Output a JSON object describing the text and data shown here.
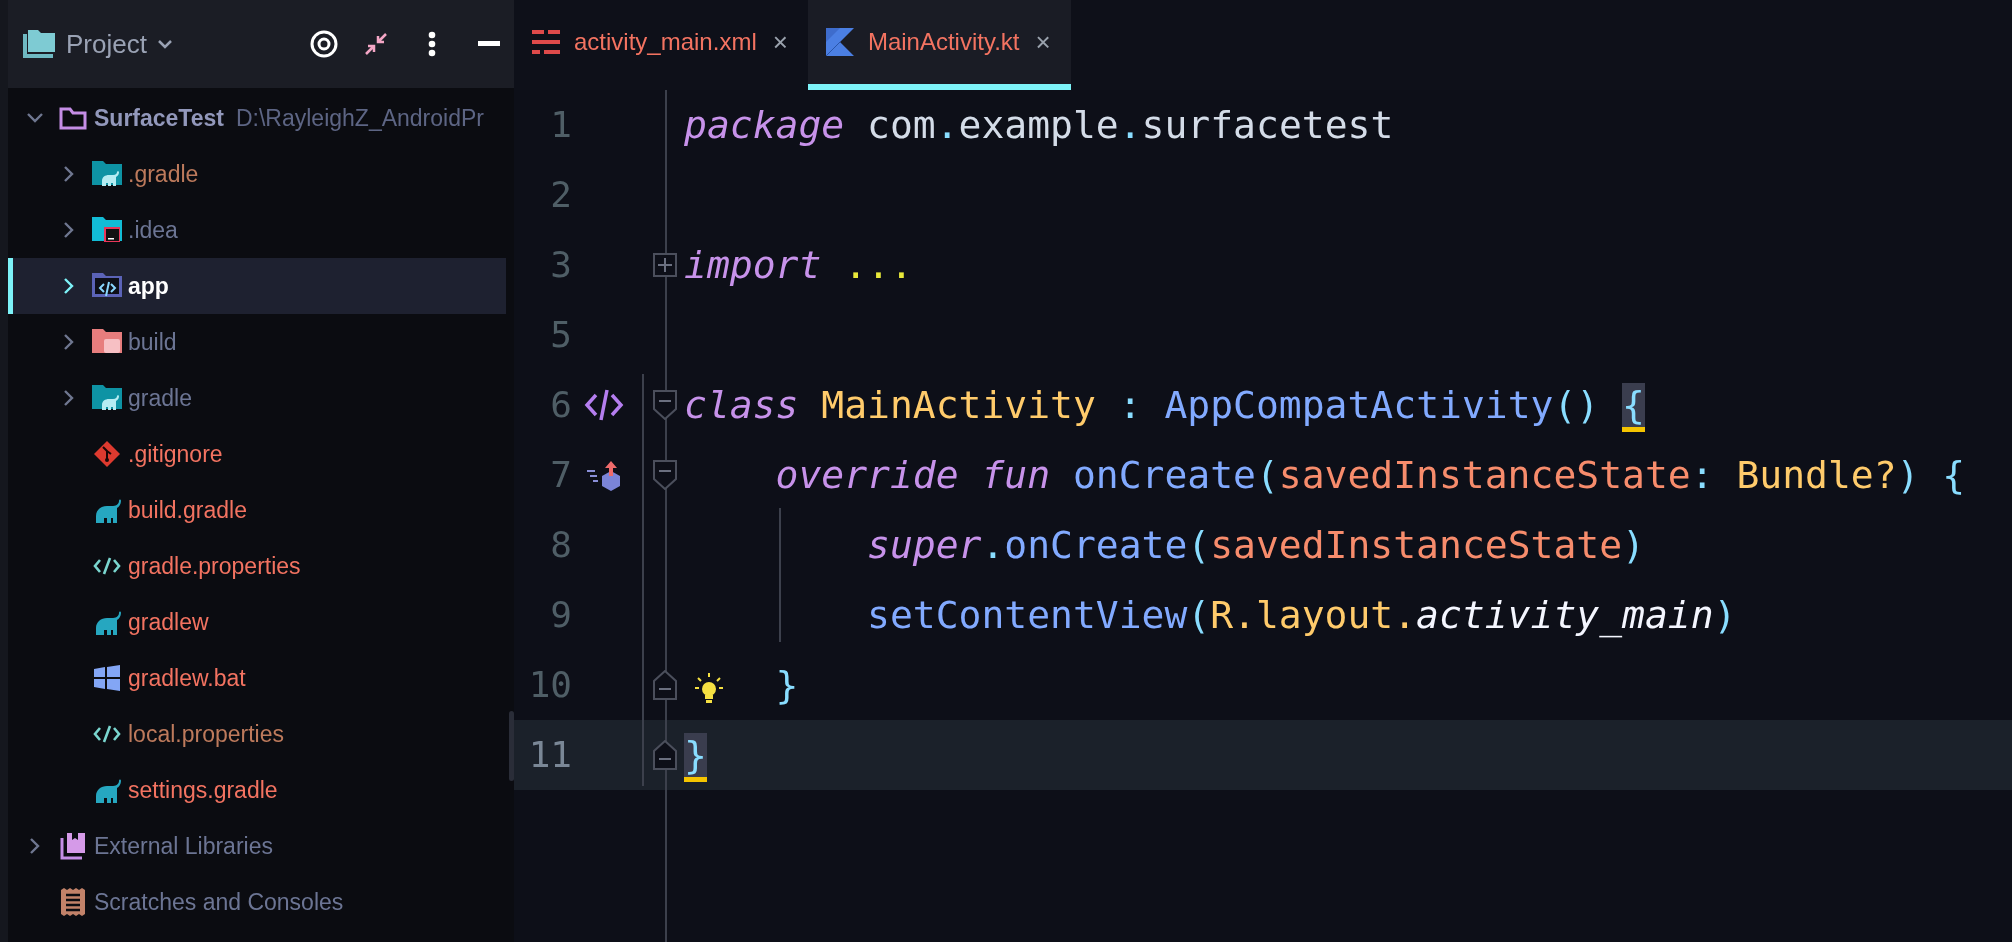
{
  "sidebar": {
    "title": "Project",
    "tree": [
      {
        "kind": "project",
        "label": "SurfaceTest",
        "path": "D:\\RayleighZ_AndroidPr",
        "color": "#9298bb",
        "expanded": true,
        "selected": false,
        "children": [
          {
            "kind": "gradle-folder",
            "label": ".gradle",
            "color": "#bd7a5c",
            "expanded": false,
            "selected": false
          },
          {
            "kind": "idea-folder",
            "label": ".idea",
            "color": "#6c7594",
            "expanded": false,
            "selected": false
          },
          {
            "kind": "module-folder",
            "label": "app",
            "color": "#ffffff",
            "expanded": false,
            "selected": true
          },
          {
            "kind": "build-folder",
            "label": "build",
            "color": "#6c7594",
            "expanded": false,
            "selected": false
          },
          {
            "kind": "gradle-folder",
            "label": "gradle",
            "color": "#6c7594",
            "expanded": false,
            "selected": false
          },
          {
            "kind": "git-file",
            "label": ".gitignore",
            "color": "#f37361",
            "selected": false
          },
          {
            "kind": "gradle-file",
            "label": "build.gradle",
            "color": "#f37361",
            "selected": false
          },
          {
            "kind": "props-file",
            "label": "gradle.properties",
            "color": "#f37361",
            "selected": false
          },
          {
            "kind": "gradle-file",
            "label": "gradlew",
            "color": "#f37361",
            "selected": false
          },
          {
            "kind": "bat-file",
            "label": "gradlew.bat",
            "color": "#f37361",
            "selected": false
          },
          {
            "kind": "props-file",
            "label": "local.properties",
            "color": "#bd7a5c",
            "selected": false
          },
          {
            "kind": "gradle-file",
            "label": "settings.gradle",
            "color": "#f37361",
            "selected": false
          }
        ]
      },
      {
        "kind": "libraries",
        "label": "External Libraries",
        "color": "#6c7594",
        "expanded": false,
        "selected": false
      },
      {
        "kind": "scratches",
        "label": "Scratches and Consoles",
        "color": "#6c7594",
        "selected": false
      }
    ]
  },
  "editor": {
    "tabs": [
      {
        "kind": "layout",
        "label": "activity_main.xml",
        "close": "×",
        "selected": false
      },
      {
        "kind": "kotlin",
        "label": "MainActivity.kt",
        "close": "×",
        "selected": true
      }
    ],
    "lines": [
      {
        "number": "1",
        "current": false,
        "tokens": [
          {
            "kind": "keyword",
            "text": "package "
          },
          {
            "kind": "plain",
            "text": "com"
          },
          {
            "kind": "punct",
            "text": "."
          },
          {
            "kind": "plain",
            "text": "example"
          },
          {
            "kind": "punct",
            "text": "."
          },
          {
            "kind": "plain",
            "text": "surfacetest"
          }
        ]
      },
      {
        "number": "2",
        "current": false
      },
      {
        "number": "3",
        "current": false,
        "fold": {
          "kind": "collapsed"
        },
        "tokens": [
          {
            "kind": "keyword",
            "text": "import "
          },
          {
            "kind": "folded",
            "text": "..."
          }
        ]
      },
      {
        "number": "5",
        "current": false
      },
      {
        "number": "6",
        "current": false,
        "gutter": {
          "kind": "implemented"
        },
        "fold": {
          "kind": "start"
        },
        "tokens": [
          {
            "kind": "keyword",
            "text": "class "
          },
          {
            "kind": "class",
            "text": "MainActivity"
          },
          {
            "kind": "punct",
            "text": " : "
          },
          {
            "kind": "func",
            "text": "AppCompatActivity"
          },
          {
            "kind": "punct",
            "text": "() "
          },
          {
            "kind": "punct",
            "text": "{",
            "match": true
          }
        ]
      },
      {
        "number": "7",
        "current": false,
        "gutter": {
          "kind": "overrides"
        },
        "fold": {
          "kind": "start"
        },
        "tokens": [
          {
            "kind": "keyword",
            "text": "    override fun "
          },
          {
            "kind": "func",
            "text": "onCreate"
          },
          {
            "kind": "punct",
            "text": "("
          },
          {
            "kind": "param",
            "text": "savedInstanceState"
          },
          {
            "kind": "punct",
            "text": ": "
          },
          {
            "kind": "class",
            "text": "Bundle?"
          },
          {
            "kind": "punct",
            "text": ") {"
          }
        ]
      },
      {
        "number": "8",
        "current": false,
        "tokens": [
          {
            "kind": "keyword",
            "text": "        super"
          },
          {
            "kind": "punct",
            "text": "."
          },
          {
            "kind": "func",
            "text": "onCreate"
          },
          {
            "kind": "punct",
            "text": "("
          },
          {
            "kind": "param",
            "text": "savedInstanceState"
          },
          {
            "kind": "punct",
            "text": ")"
          }
        ]
      },
      {
        "number": "9",
        "current": false,
        "tokens": [
          {
            "kind": "func",
            "text": "        setContentView"
          },
          {
            "kind": "punct",
            "text": "("
          },
          {
            "kind": "class",
            "text": "R.layout."
          },
          {
            "kind": "prop",
            "text": "activity_main"
          },
          {
            "kind": "punct",
            "text": ")"
          }
        ]
      },
      {
        "number": "10",
        "current": false,
        "fold": {
          "kind": "end"
        },
        "intention": true,
        "tokens": [
          {
            "kind": "punct",
            "text": "    }"
          }
        ]
      },
      {
        "number": "11",
        "current": true,
        "fold": {
          "kind": "end"
        },
        "tokens": [
          {
            "kind": "punct",
            "text": "}",
            "match": true
          }
        ]
      }
    ]
  }
}
